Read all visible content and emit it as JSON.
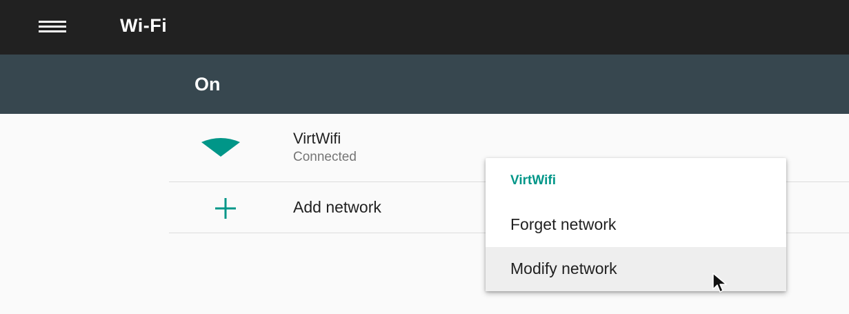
{
  "toolbar": {
    "title": "Wi-Fi",
    "menu_icon": "hamburger-menu-icon"
  },
  "switch_bar": {
    "label": "On"
  },
  "networks": [
    {
      "name": "VirtWifi",
      "status": "Connected",
      "icon": "wifi-signal-icon"
    }
  ],
  "add_network": {
    "label": "Add network",
    "icon": "plus-icon"
  },
  "context_menu": {
    "title": "VirtWifi",
    "items": [
      {
        "label": "Forget network"
      },
      {
        "label": "Modify network"
      }
    ]
  },
  "colors": {
    "toolbar": "#212121",
    "switch_bar": "#37474f",
    "accent": "#009688",
    "background": "#fafafa"
  }
}
